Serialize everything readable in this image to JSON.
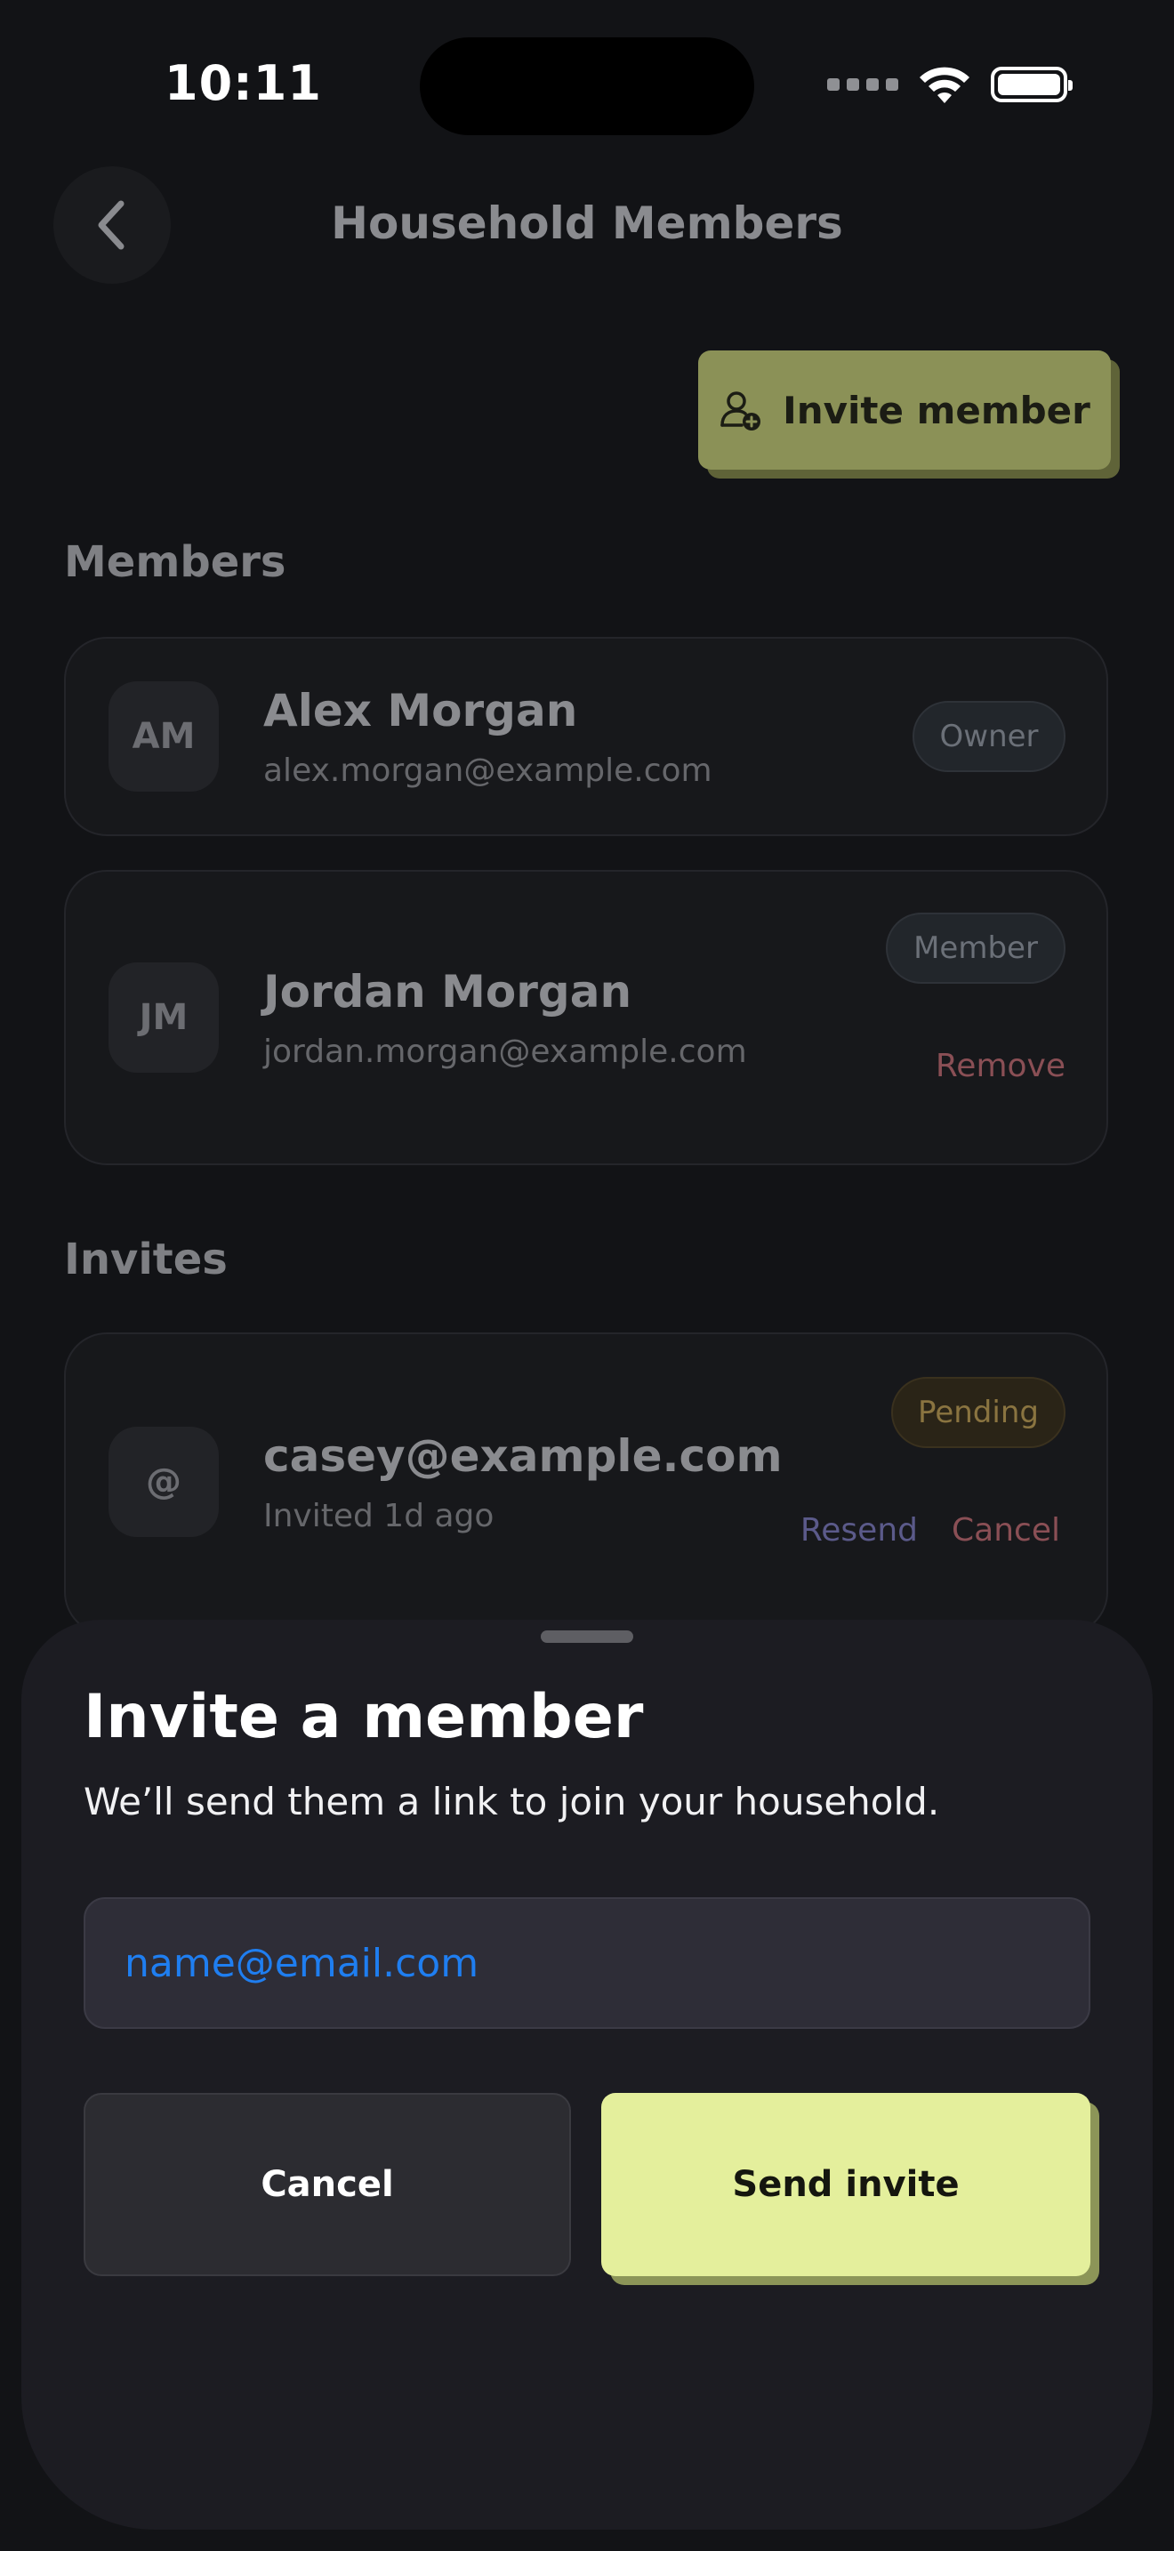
{
  "status_bar": {
    "time": "10:11"
  },
  "header": {
    "title": "Household Members"
  },
  "actions": {
    "invite_member_label": "Invite member"
  },
  "members_section": {
    "title": "Members",
    "members": [
      {
        "initials": "AM",
        "name": "Alex Morgan",
        "email": "alex.morgan@example.com",
        "role": "Owner"
      },
      {
        "initials": "JM",
        "name": "Jordan Morgan",
        "email": "jordan.morgan@example.com",
        "role": "Member",
        "remove_label": "Remove"
      }
    ]
  },
  "invites_section": {
    "title": "Invites",
    "invites": [
      {
        "avatar_symbol": "@",
        "email": "casey@example.com",
        "meta": "Invited 1d ago",
        "status": "Pending",
        "resend_label": "Resend",
        "cancel_label": "Cancel"
      }
    ]
  },
  "invite_sheet": {
    "title": "Invite a member",
    "subtitle": "We’ll send them a link to join your household.",
    "email_placeholder": "name@email.com",
    "cancel_label": "Cancel",
    "send_label": "Send invite"
  },
  "colors": {
    "accent": "#e4ef9c",
    "accent_shadow": "#8c9558",
    "link_blue": "#1f7ef0",
    "danger": "#8a4f55"
  },
  "icons": {
    "back": "chevron-left-icon",
    "invite": "user-plus-icon",
    "wifi": "wifi-icon",
    "battery": "battery-icon",
    "signal": "cellular-signal-icon"
  }
}
